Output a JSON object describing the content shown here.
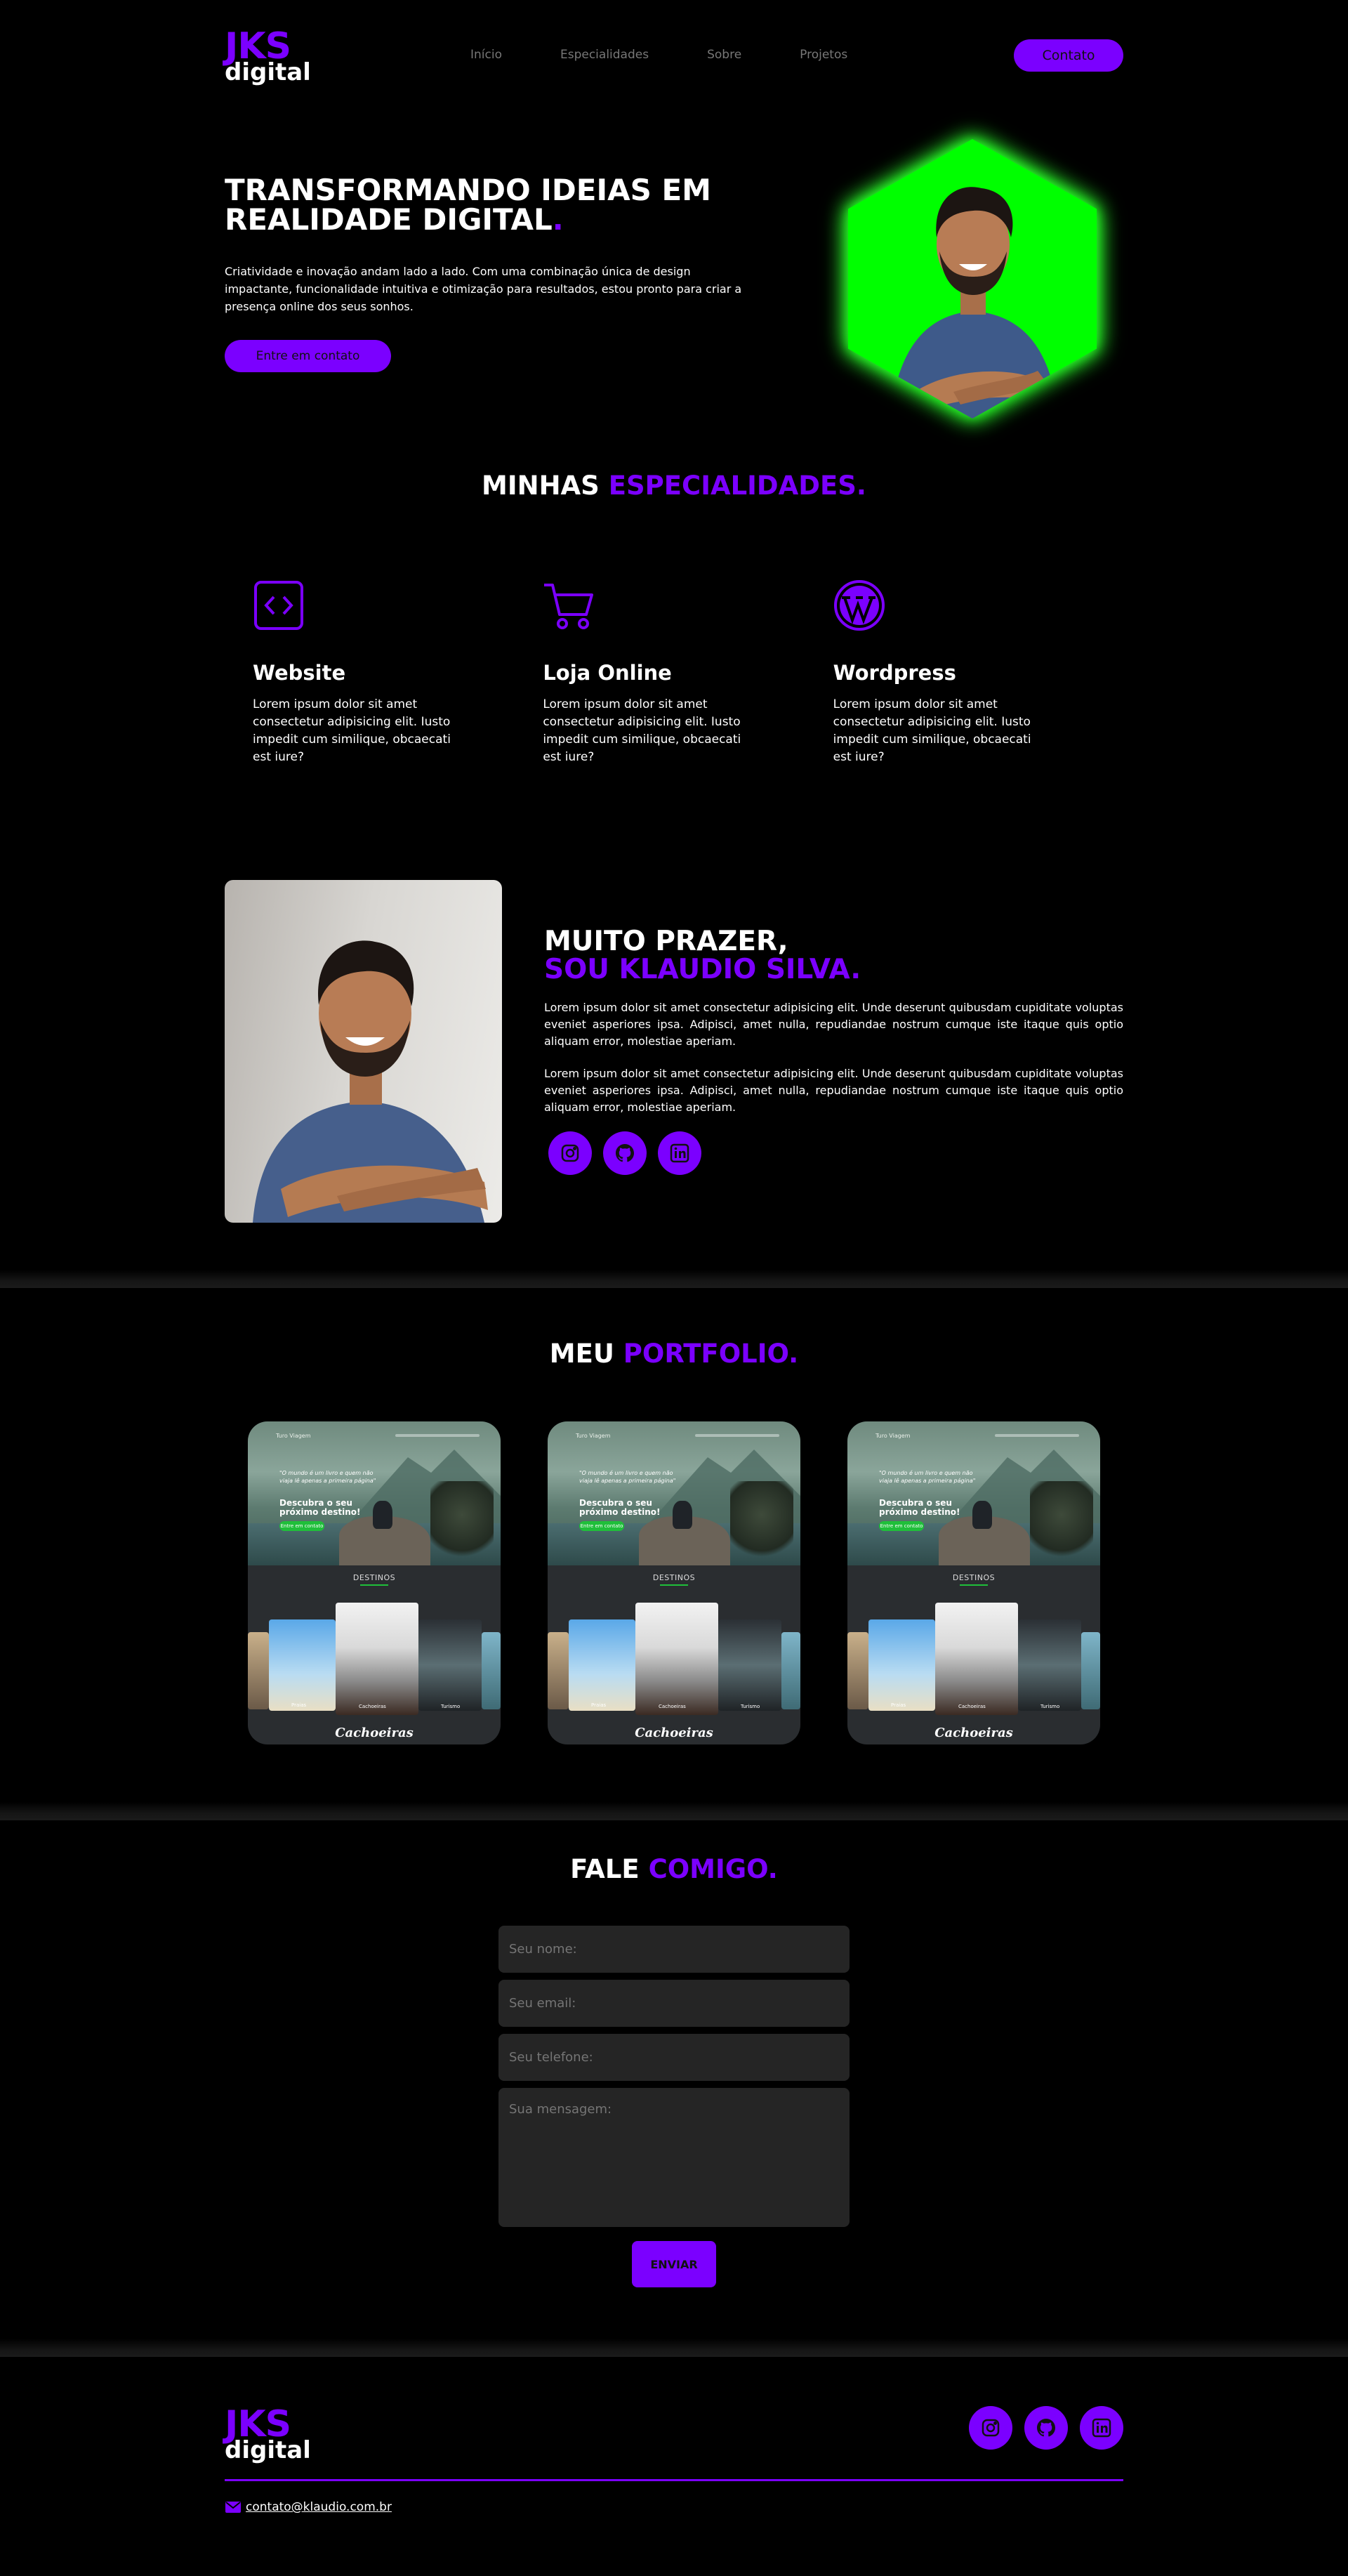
{
  "brand": {
    "logo_top": "JKS",
    "logo_bottom": "digital",
    "accent": "#7b00ff",
    "highlight": "#00ff00"
  },
  "nav": {
    "items": [
      "Início",
      "Especialidades",
      "Sobre",
      "Projetos"
    ],
    "cta": "Contato"
  },
  "hero": {
    "title_main": "TRANSFORMANDO IDEIAS EM REALIDADE DIGITAL",
    "title_dot": ".",
    "text": "Criatividade e inovação andam lado a lado. Com uma combinação única de design impactante, funcionalidade intuitiva e otimização para resultados, estou pronto para criar a presença online dos seus sonhos.",
    "button": "Entre em contato"
  },
  "specialties": {
    "title_white": "MINHAS",
    "title_purple": "ESPECIALIDADES.",
    "cards": [
      {
        "icon": "code-icon",
        "title": "Website",
        "text": "Lorem ipsum dolor sit amet consectetur adipisicing elit. Iusto impedit cum similique, obcaecati est iure?"
      },
      {
        "icon": "cart-icon",
        "title": "Loja Online",
        "text": "Lorem ipsum dolor sit amet consectetur adipisicing elit. Iusto impedit cum similique, obcaecati est iure?"
      },
      {
        "icon": "wordpress-icon",
        "title": "Wordpress",
        "text": "Lorem ipsum dolor sit amet consectetur adipisicing elit. Iusto impedit cum similique, obcaecati est iure?"
      }
    ]
  },
  "about": {
    "title_line1": "MUITO PRAZER,",
    "title_line2": "SOU KLAUDIO SILVA.",
    "p1": "Lorem ipsum dolor sit amet consectetur adipisicing elit. Unde deserunt quibusdam cupiditate voluptas eveniet asperiores ipsa. Adipisci, amet nulla, repudiandae nostrum cumque iste itaque quis optio aliquam error, molestiae aperiam.",
    "p2": "Lorem ipsum dolor sit amet consectetur adipisicing elit. Unde deserunt quibusdam cupiditate voluptas eveniet asperiores ipsa. Adipisci, amet nulla, repudiandae nostrum cumque iste itaque quis optio aliquam error, molestiae aperiam.",
    "socials": [
      "instagram-icon",
      "github-icon",
      "linkedin-icon"
    ]
  },
  "portfolio": {
    "title_white": "MEU",
    "title_purple": "PORTFOLIO.",
    "card": {
      "site_name": "Turo Viagem",
      "quote": "\"O mundo é um livro e quem não viaja lê apenas a primeira página\"",
      "headline": "Descubra o seu próximo destino!",
      "button": "Entre em contato",
      "section": "DESTINOS",
      "labels": [
        "Praias",
        "Cachoeiras",
        "Turismo"
      ],
      "caption": "Cachoeiras"
    }
  },
  "contact": {
    "title_white": "FALE",
    "title_purple": "COMIGO.",
    "name_placeholder": "Seu nome:",
    "email_placeholder": "Seu email:",
    "phone_placeholder": "Seu telefone:",
    "message_placeholder": "Sua mensagem:",
    "submit": "ENVIAR"
  },
  "footer": {
    "email": "contato@klaudio.com.br",
    "socials": [
      "instagram-icon",
      "github-icon",
      "linkedin-icon"
    ]
  }
}
